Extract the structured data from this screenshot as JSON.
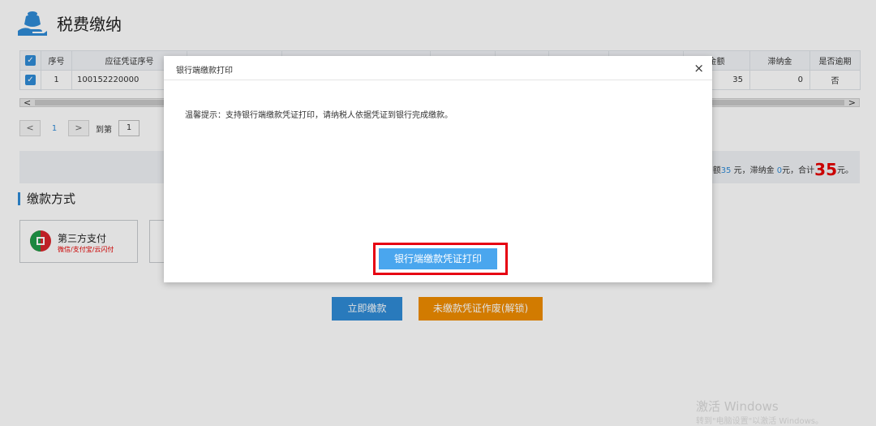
{
  "page": {
    "title": "税费缴纳"
  },
  "table": {
    "headers": [
      "序号",
      "应征凭证序号",
      "金额",
      "滞纳金",
      "是否逾期"
    ],
    "row": {
      "index": "1",
      "voucher_no": "100152220000",
      "amount": "35",
      "late_fee": "0",
      "overdue": "否"
    }
  },
  "scroll": {
    "left": "<",
    "right": ">"
  },
  "pager": {
    "prev": "<",
    "page": "1",
    "next": ">",
    "goto_label": "到第",
    "goto_value": "1"
  },
  "summary": {
    "amount_prefix": "额",
    "amount_value": "35",
    "amount_suffix": " 元，滞纳金 ",
    "late_value": "0",
    "late_suffix": "元，合计",
    "total_value": "35",
    "total_suffix": "元。"
  },
  "payment": {
    "section_title": "缴款方式",
    "third_party_name": "第三方支付",
    "third_party_sub": "微信/支付宝/云闪付",
    "pay_now": "立即缴款",
    "void_unlock": "未缴款凭证作废(解锁)"
  },
  "modal": {
    "title": "银行端缴款打印",
    "close": "×",
    "tip": "温馨提示：支持银行端缴款凭证打印，请纳税人依据凭证到银行完成缴款。",
    "print_button": "银行端缴款凭证打印"
  },
  "watermark": {
    "line1": "激活 Windows",
    "line2": "转到\"电脑设置\"以激活 Windows。"
  },
  "colors": {
    "accent": "#2f8bd7",
    "orange": "#f08c00",
    "red": "#e60012",
    "print_button": "#4aa6ee"
  }
}
